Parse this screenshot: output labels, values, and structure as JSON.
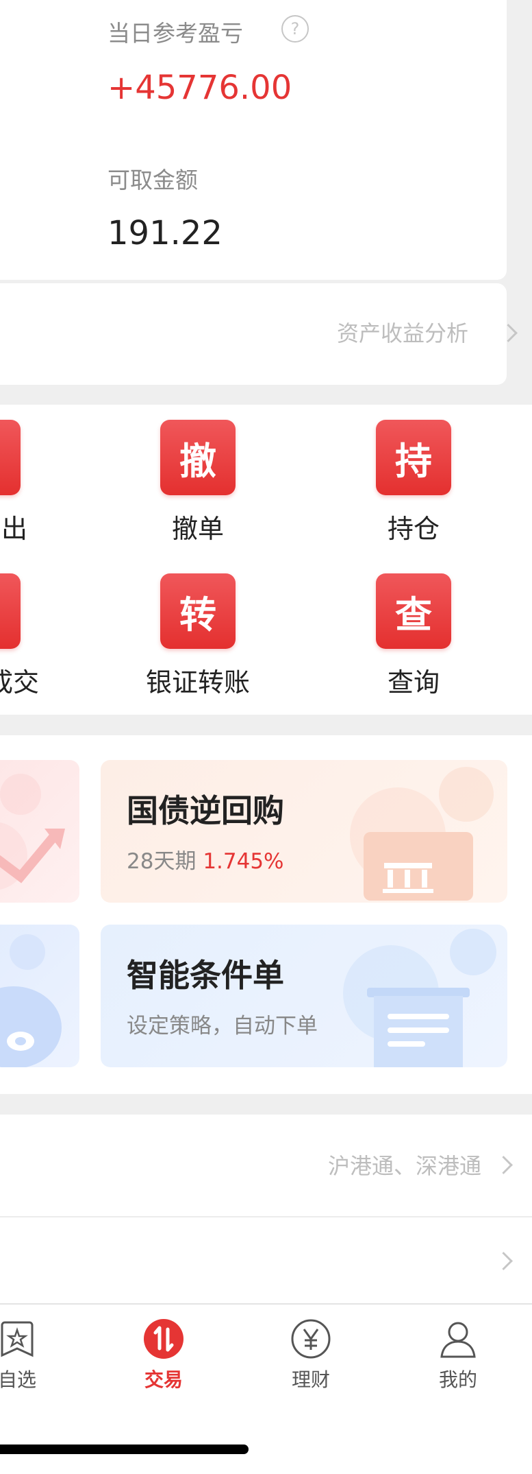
{
  "asset": {
    "pnl_label": "当日参考盈亏",
    "pnl_help": "?",
    "pnl_value": "+45776.00",
    "available_label": "可取金额",
    "available_value": "191.22",
    "analysis_link": "资产收益分析"
  },
  "functions": [
    {
      "glyph": "撤",
      "label": "撤单"
    },
    {
      "glyph": "持",
      "label": "持仓"
    },
    {
      "glyph": "转",
      "label": "银证转账"
    },
    {
      "glyph": "查",
      "label": "查询"
    }
  ],
  "functions_partial": [
    {
      "label": "出"
    },
    {
      "label": "成交"
    }
  ],
  "promos": [
    {
      "title": "国债逆回购",
      "sub_prefix": "28天期",
      "sub_rate": "1.745%"
    },
    {
      "title": "智能条件单",
      "sub_text": "设定策略，自动下单"
    }
  ],
  "list": [
    {
      "link": "沪港通、深港通"
    },
    {
      "link": ""
    }
  ],
  "tabs": [
    {
      "label": "自选",
      "icon": "star-icon",
      "active": false
    },
    {
      "label": "交易",
      "icon": "trade-icon",
      "active": true
    },
    {
      "label": "理财",
      "icon": "yen-icon",
      "active": false
    },
    {
      "label": "我的",
      "icon": "person-icon",
      "active": false
    }
  ],
  "colors": {
    "accent_red": "#e53534",
    "promo_orange_bg": "#fdeee6",
    "promo_blue_bg": "#e6f0fd"
  }
}
